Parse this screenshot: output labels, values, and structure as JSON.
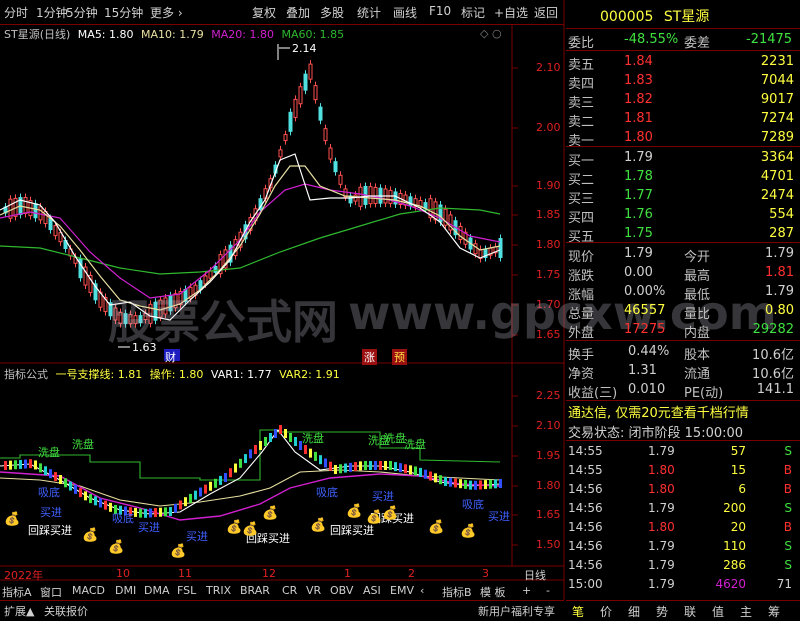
{
  "toolbar": {
    "items": [
      "分时",
      "1分钟",
      "5分钟",
      "15分钟",
      "更多 ›",
      "复权",
      "叠加",
      "多股",
      "统计",
      "画线",
      "F10",
      "标记",
      "+自选",
      "返回"
    ]
  },
  "main_chart": {
    "title": "ST星源(日线)",
    "ma5": "MA5: 1.80",
    "ma10": "MA10: 1.79",
    "ma20": "MA20: 1.80",
    "ma60": "MA60: 1.85",
    "high_label": "2.14",
    "low_label": "1.63",
    "axis": [
      "2.10",
      "2.00",
      "1.90",
      "1.85",
      "1.80",
      "1.75",
      "1.70",
      "1.65"
    ],
    "tags": {
      "cai": "财",
      "zhang": "涨",
      "yu": "预"
    }
  },
  "indicator": {
    "title": "指标公式",
    "line1": "一号支撑线: 1.81",
    "line2": "操作: 1.80",
    "var1": "VAR1: 1.77",
    "var2": "VAR2: 1.91",
    "axis": [
      "2.25",
      "2.10",
      "1.95",
      "1.80",
      "1.65",
      "1.50"
    ],
    "labels": {
      "xipan": "洗盘",
      "xidi": "吸底",
      "maijin": "买进",
      "huicai": "回踩买进"
    }
  },
  "date_axis": {
    "year": "2022年",
    "months": [
      "10",
      "11",
      "12",
      "1",
      "2",
      "3"
    ],
    "period": "日线"
  },
  "bottom_tabs": {
    "row1": [
      "指标A",
      "窗口",
      "MACD",
      "DMI",
      "DMA",
      "FSL",
      "TRIX",
      "BRAR",
      "CR",
      "VR",
      "OBV",
      "ASI",
      "EMV",
      "‹",
      "指标B",
      "模 板",
      "+",
      "-"
    ],
    "row2": [
      "扩展▲",
      "关联报价"
    ]
  },
  "quote": {
    "code": "000005",
    "name": "ST星源",
    "weibi_label": "委比",
    "weibi": "-48.55%",
    "weicha_label": "委差",
    "weicha": "-21475",
    "asks": [
      {
        "label": "卖五",
        "price": "1.84",
        "vol": "2231"
      },
      {
        "label": "卖四",
        "price": "1.83",
        "vol": "7044"
      },
      {
        "label": "卖三",
        "price": "1.82",
        "vol": "9017"
      },
      {
        "label": "卖二",
        "price": "1.81",
        "vol": "7274"
      },
      {
        "label": "卖一",
        "price": "1.80",
        "vol": "7289"
      }
    ],
    "bids": [
      {
        "label": "买一",
        "price": "1.79",
        "vol": "3364"
      },
      {
        "label": "买二",
        "price": "1.78",
        "vol": "4701"
      },
      {
        "label": "买三",
        "price": "1.77",
        "vol": "2474"
      },
      {
        "label": "买四",
        "price": "1.76",
        "vol": "554"
      },
      {
        "label": "买五",
        "price": "1.75",
        "vol": "287"
      }
    ],
    "stats": [
      {
        "l1": "现价",
        "v1": "1.79",
        "l2": "今开",
        "v2": "1.79"
      },
      {
        "l1": "涨跌",
        "v1": "0.00",
        "l2": "最高",
        "v2": "1.81"
      },
      {
        "l1": "涨幅",
        "v1": "0.00%",
        "l2": "最低",
        "v2": "1.79"
      },
      {
        "l1": "总量",
        "v1": "46557",
        "l2": "量比",
        "v2": "0.80"
      },
      {
        "l1": "外盘",
        "v1": "17275",
        "l2": "内盘",
        "v2": "29282"
      }
    ],
    "stats2": [
      {
        "l1": "换手",
        "v1": "0.44%",
        "l2": "股本",
        "v2": "10.6亿"
      },
      {
        "l1": "净资",
        "v1": "1.31",
        "l2": "流通",
        "v2": "10.6亿"
      },
      {
        "l1": "收益(三)",
        "v1": "0.010",
        "l2": "PE(动)",
        "v2": "141.1"
      }
    ],
    "promo": "通达信, 仅需20元查看千档行情",
    "status_label": "交易状态:",
    "status": "闭市阶段 15:00:00",
    "ticks": [
      {
        "time": "14:55",
        "price": "1.79",
        "vol": "57",
        "bs": "S"
      },
      {
        "time": "14:55",
        "price": "1.80",
        "vol": "15",
        "bs": "B"
      },
      {
        "time": "14:56",
        "price": "1.80",
        "vol": "6",
        "bs": "B"
      },
      {
        "time": "14:56",
        "price": "1.79",
        "vol": "200",
        "bs": "S"
      },
      {
        "time": "14:56",
        "price": "1.80",
        "vol": "20",
        "bs": "B"
      },
      {
        "time": "14:56",
        "price": "1.79",
        "vol": "110",
        "bs": "S"
      },
      {
        "time": "14:56",
        "price": "1.79",
        "vol": "286",
        "bs": "S"
      },
      {
        "time": "15:00",
        "price": "1.79",
        "vol": "4620",
        "bs": "71"
      }
    ],
    "bottom_tabs": [
      "新用户福利专享",
      "笔",
      "价",
      "细",
      "势",
      "联",
      "值",
      "主",
      "筹"
    ]
  },
  "watermark": {
    "cn": "股票公式网",
    "en": "www.gpcxw.com"
  }
}
